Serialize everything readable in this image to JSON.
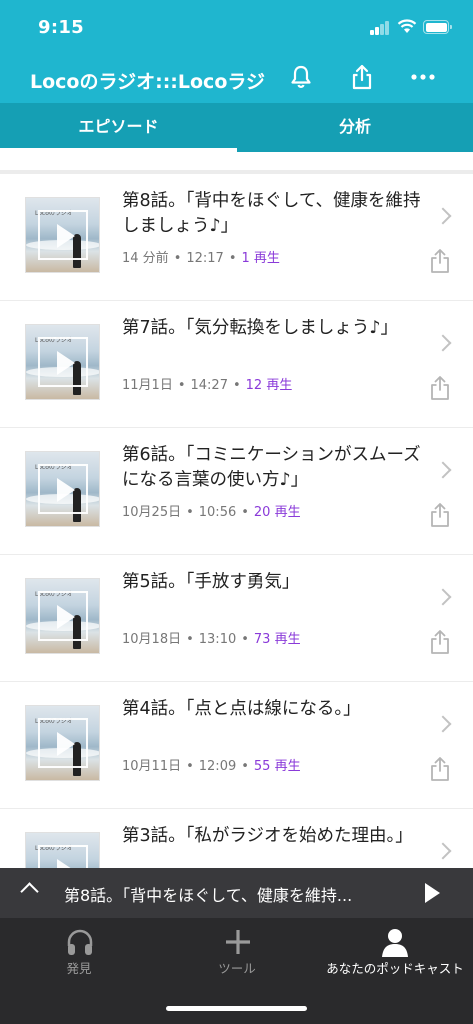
{
  "status_bar": {
    "time": "9:15"
  },
  "header": {
    "title": "Locoのラジオ:::Locoラジ",
    "icons": [
      "bell-icon",
      "share-icon",
      "more-icon"
    ]
  },
  "tabs": [
    {
      "label": "エピソード",
      "active": true
    },
    {
      "label": "分析",
      "active": false
    }
  ],
  "episodes": [
    {
      "title": "第8話。「背中をほぐして、健康を維持しましょう♪」",
      "date": "14 分前",
      "time": "12:17",
      "plays": "1 再生"
    },
    {
      "title": "第7話。「気分転換をしましょう♪」",
      "date": "11月1日",
      "time": "14:27",
      "plays": "12 再生"
    },
    {
      "title": "第6話。「コミニケーションがスムーズになる言葉の使い方♪」",
      "date": "10月25日",
      "time": "10:56",
      "plays": "20 再生"
    },
    {
      "title": "第5話。「手放す勇気」",
      "date": "10月18日",
      "time": "13:10",
      "plays": "73 再生"
    },
    {
      "title": "第4話。「点と点は線になる。」",
      "date": "10月11日",
      "time": "12:09",
      "plays": "55 再生"
    },
    {
      "title": "第3話。「私がラジオを始めた理由。」",
      "date": "",
      "time": "",
      "plays": ""
    }
  ],
  "thumbnail_text": "Locoのラジオ",
  "meta_separator": "•",
  "mini_player": {
    "now_playing": "第8話。「背中をほぐして、健康を維持..."
  },
  "bottom_nav": [
    {
      "label": "発見",
      "icon": "headphones-icon",
      "active": false
    },
    {
      "label": "ツール",
      "icon": "plus-icon",
      "active": false
    },
    {
      "label": "あなたのポッドキャスト",
      "icon": "person-icon",
      "active": true
    }
  ],
  "colors": {
    "header": "#1fb6cf",
    "tabbar": "#159fb4",
    "plays": "#8a3ad9",
    "nav": "#2a2a2c"
  }
}
